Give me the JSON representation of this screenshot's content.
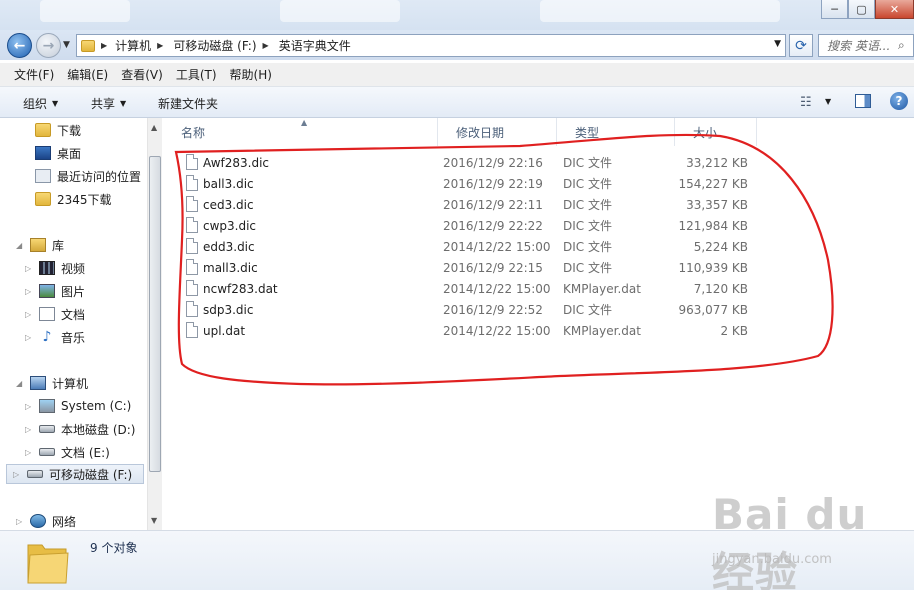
{
  "window": {
    "min_glyph": "─",
    "max_glyph": "▢",
    "close_glyph": "✕"
  },
  "address": {
    "crumbs": [
      "计算机",
      "可移动磁盘 (F:)",
      "英语字典文件"
    ]
  },
  "search": {
    "placeholder": "搜索 英语..."
  },
  "menu": [
    "文件(F)",
    "编辑(E)",
    "查看(V)",
    "工具(T)",
    "帮助(H)"
  ],
  "toolbar": {
    "organize": "组织",
    "share": "共享",
    "new_folder": "新建文件夹"
  },
  "nav": {
    "downloads": "下载",
    "desktop": "桌面",
    "recent": "最近访问的位置",
    "d2345": "2345下载",
    "libraries": "库",
    "videos": "视频",
    "pictures": "图片",
    "documents": "文档",
    "music": "音乐",
    "computer": "计算机",
    "drive_c": "System (C:)",
    "drive_d": "本地磁盘 (D:)",
    "drive_e": "文档 (E:)",
    "drive_f": "可移动磁盘 (F:)",
    "network": "网络"
  },
  "columns": {
    "name": "名称",
    "date": "修改日期",
    "type": "类型",
    "size": "大小"
  },
  "files": [
    {
      "name": "Awf283.dic",
      "date": "2016/12/9 22:16",
      "type": "DIC 文件",
      "size": "33,212 KB"
    },
    {
      "name": "ball3.dic",
      "date": "2016/12/9 22:19",
      "type": "DIC 文件",
      "size": "154,227 KB"
    },
    {
      "name": "ced3.dic",
      "date": "2016/12/9 22:11",
      "type": "DIC 文件",
      "size": "33,357 KB"
    },
    {
      "name": "cwp3.dic",
      "date": "2016/12/9 22:22",
      "type": "DIC 文件",
      "size": "121,984 KB"
    },
    {
      "name": "edd3.dic",
      "date": "2014/12/22 15:00",
      "type": "DIC 文件",
      "size": "5,224 KB"
    },
    {
      "name": "mall3.dic",
      "date": "2016/12/9 22:15",
      "type": "DIC 文件",
      "size": "110,939 KB"
    },
    {
      "name": "ncwf283.dat",
      "date": "2014/12/22 15:00",
      "type": "KMPlayer.dat",
      "size": "7,120 KB"
    },
    {
      "name": "sdp3.dic",
      "date": "2016/12/9 22:52",
      "type": "DIC 文件",
      "size": "963,077 KB"
    },
    {
      "name": "upl.dat",
      "date": "2014/12/22 15:00",
      "type": "KMPlayer.dat",
      "size": "2 KB"
    }
  ],
  "status": {
    "count": "9 个对象"
  },
  "watermark": {
    "logo": "Bai du 经验",
    "url": "jingyan.baidu.com"
  },
  "colors": {
    "annotation": "#e02020",
    "accent": "#2a64ad"
  }
}
